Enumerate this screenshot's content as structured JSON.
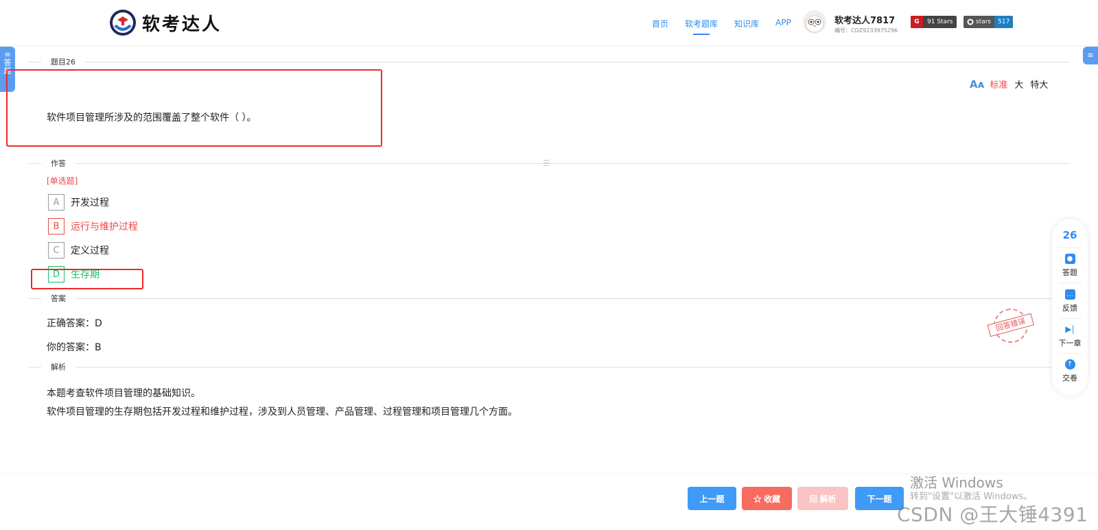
{
  "header": {
    "logo_text": "软考达人",
    "nav": [
      {
        "label": "首页",
        "active": false
      },
      {
        "label": "软考题库",
        "active": true
      },
      {
        "label": "知识库",
        "active": false
      },
      {
        "label": "APP",
        "active": false
      }
    ],
    "user": {
      "name": "软考达人7817",
      "id": "编号：CDZ9233975296"
    },
    "gitee_badge": "91 Stars",
    "github_badge": {
      "left": "stars",
      "right": "517"
    }
  },
  "left_tab_label": "≡ 答 题",
  "right_tab_label": "≡",
  "question": {
    "section_label": "题目26",
    "text": "软件项目管理所涉及的范围覆盖了整个软件（ ）。",
    "font_size": {
      "standard": "标准",
      "large": "大",
      "xlarge": "特大"
    }
  },
  "answer_section": {
    "label": "作答",
    "type": "[单选题]",
    "options": [
      {
        "letter": "A",
        "text": "开发过程",
        "state": "normal"
      },
      {
        "letter": "B",
        "text": "运行与维护过程",
        "state": "wrong"
      },
      {
        "letter": "C",
        "text": "定义过程",
        "state": "normal"
      },
      {
        "letter": "D",
        "text": "生存期",
        "state": "correct"
      }
    ]
  },
  "result": {
    "label": "答案",
    "correct": "正确答案：D",
    "yours": "你的答案：B",
    "stamp": "回答错误"
  },
  "analysis": {
    "label": "解析",
    "lines": [
      "本题考查软件项目管理的基础知识。",
      "软件项目管理的生存期包括开发过程和维护过程，涉及到人员管理、产品管理、过程管理和项目管理几个方面。"
    ]
  },
  "float_panel": {
    "number": "26",
    "items": [
      "答题",
      "反馈",
      "下一章",
      "交卷"
    ]
  },
  "buttons": {
    "prev": "上一题",
    "favorite": "☆ 收藏",
    "analysis": "▤ 解析",
    "next": "下一题"
  },
  "watermark": {
    "activate_title": "激活 Windows",
    "activate_sub": "转到\"设置\"以激活 Windows。",
    "csdn": "CSDN @王大锤4391"
  },
  "colors": {
    "accent": "#2d8cf0",
    "wrong": "#ed4949",
    "correct": "#19be6b"
  }
}
